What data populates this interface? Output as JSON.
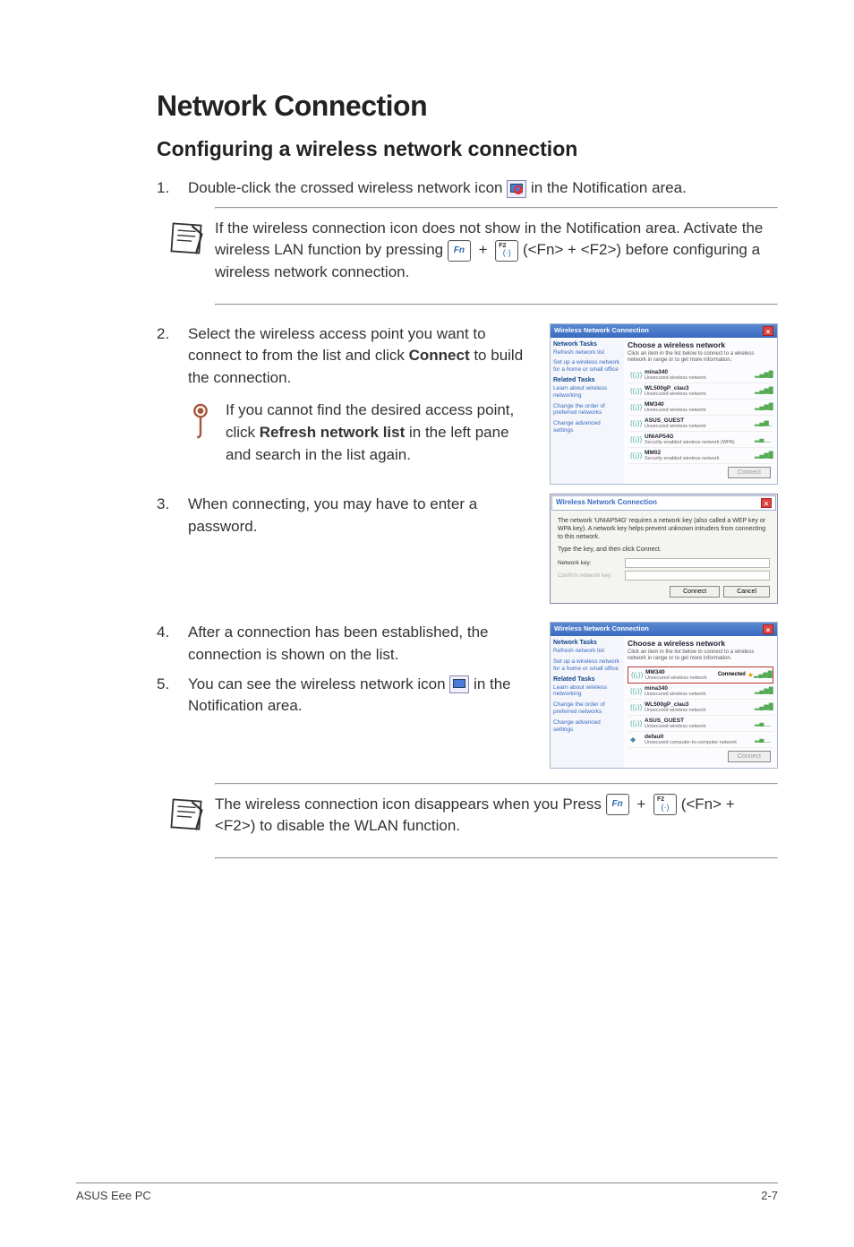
{
  "heading": "Network Connection",
  "subheading": "Configuring a wireless network connection",
  "step1": {
    "num": "1.",
    "text_a": "Double-click the crossed wireless network icon ",
    "text_b": " in the Notification area."
  },
  "note1": {
    "line1": "If the wireless connection icon does not show in the Notification area. Activate the wireless LAN function by pressing ",
    "plus": " + ",
    "line2": " (<Fn> + <F2>) before configuring a wireless network connection."
  },
  "step2": {
    "num": "2.",
    "text_a": "Select the wireless access point you want to connect to from the list and click ",
    "bold": "Connect",
    "text_b": " to build the connection."
  },
  "tip1": {
    "text_a": "If you cannot find the desired access point, click ",
    "bold": "Refresh network list",
    "text_b": " in the left pane and search in the list again."
  },
  "step3": {
    "num": "3.",
    "text": "When connecting, you may have to enter a password."
  },
  "step4": {
    "num": "4.",
    "text": "After a connection has been established, the connection is shown on the list."
  },
  "step5": {
    "num": "5.",
    "text_a": "You can see the wireless network icon ",
    "text_b": " in the Notification area."
  },
  "note2": {
    "line1": "The wireless connection icon disappears when you Press ",
    "plus": " + ",
    "line2": " (<Fn> + <F2>) to disable the WLAN function."
  },
  "key_fn": "Fn",
  "key_f2_sup": "F2",
  "key_f2_ant": "(·)",
  "ss1": {
    "title": "Wireless Network Connection",
    "sidebar_h1": "Network Tasks",
    "sidebar_l1": "Refresh network list",
    "sidebar_l2": "Set up a wireless network for a home or small office",
    "sidebar_h2": "Related Tasks",
    "sidebar_l3": "Learn about wireless networking",
    "sidebar_l4": "Change the order of preferred networks",
    "sidebar_l5": "Change advanced settings",
    "main_title": "Choose a wireless network",
    "main_sub": "Click an item in the list below to connect to a wireless network in range or to get more information.",
    "nets": [
      {
        "name": "mina340",
        "desc": "Unsecured wireless network"
      },
      {
        "name": "WL500gP_clau3",
        "desc": "Unsecured wireless network"
      },
      {
        "name": "MM340",
        "desc": "Unsecured wireless network"
      },
      {
        "name": "ASUS_GUEST",
        "desc": "Unsecured wireless network"
      },
      {
        "name": "UNIAP54G",
        "desc": "Security-enabled wireless network (WPA)"
      },
      {
        "name": "MM02",
        "desc": "Security-enabled wireless network"
      }
    ],
    "btn": "Connect"
  },
  "pw": {
    "title": "Wireless Network Connection",
    "msg": "The network 'UNIAP54G' requires a network key (also called a WEP key or WPA key). A network key helps prevent unknown intruders from connecting to this network.",
    "msg2": "Type the key, and then click Connect.",
    "lbl1": "Network key:",
    "lbl2": "Confirm network key:",
    "btn_ok": "Connect",
    "btn_cancel": "Cancel"
  },
  "ss2": {
    "title": "Wireless Network Connection",
    "main_title": "Choose a wireless network",
    "main_sub": "Click an item in the list below to connect to a wireless network in range or to get more information.",
    "nets": [
      {
        "name": "MM340",
        "desc": "Unsecured wireless network",
        "status": "Connected"
      },
      {
        "name": "mina340",
        "desc": "Unsecured wireless network"
      },
      {
        "name": "WL500gP_clau3",
        "desc": "Unsecured wireless network"
      },
      {
        "name": "ASUS_GUEST",
        "desc": "Unsecured wireless network"
      },
      {
        "name": "default",
        "desc": "Unsecured computer-to-computer network"
      }
    ],
    "btn": "Connect"
  },
  "footer": {
    "left": "ASUS Eee PC",
    "right": "2-7"
  }
}
